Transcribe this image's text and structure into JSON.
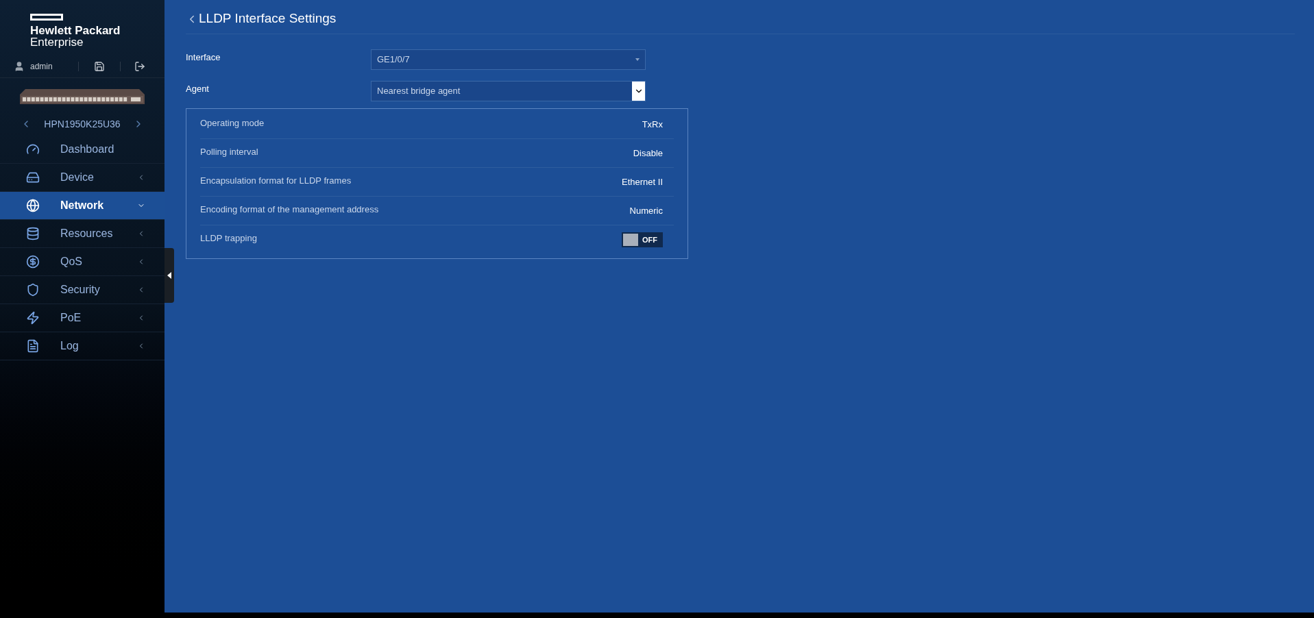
{
  "sidebar": {
    "logo": {
      "line1": "Hewlett Packard",
      "line2": "Enterprise"
    },
    "user": "admin",
    "device": "HPN1950K25U36",
    "items": [
      {
        "label": "Dashboard",
        "selected": false,
        "expandable": false
      },
      {
        "label": "Device",
        "selected": false,
        "expandable": true
      },
      {
        "label": "Network",
        "selected": true,
        "expandable": true
      },
      {
        "label": "Resources",
        "selected": false,
        "expandable": true
      },
      {
        "label": "QoS",
        "selected": false,
        "expandable": true
      },
      {
        "label": "Security",
        "selected": false,
        "expandable": true
      },
      {
        "label": "PoE",
        "selected": false,
        "expandable": true
      },
      {
        "label": "Log",
        "selected": false,
        "expandable": true
      }
    ]
  },
  "page": {
    "title": "LLDP Interface Settings",
    "fields": [
      {
        "label": "Interface",
        "value": "GE1/0/7",
        "kind": "select"
      },
      {
        "label": "Agent",
        "value": "Nearest bridge agent",
        "kind": "dropdown"
      }
    ],
    "settings": [
      {
        "label": "Operating mode",
        "kind": "text",
        "value": "TxRx"
      },
      {
        "label": "Polling interval",
        "kind": "text",
        "value": "Disable"
      },
      {
        "label": "Encapsulation format for LLDP frames",
        "kind": "text",
        "value": "Ethernet II"
      },
      {
        "label": "Encoding format of the management address",
        "kind": "text",
        "value": "Numeric"
      },
      {
        "label": "LLDP trapping",
        "kind": "toggle",
        "on": false,
        "value": "OFF"
      }
    ]
  }
}
